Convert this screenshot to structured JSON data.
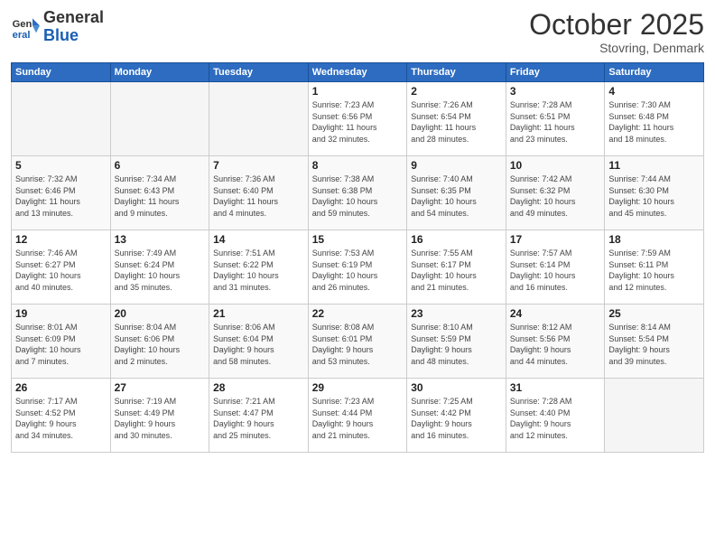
{
  "logo": {
    "line1": "General",
    "line2": "Blue"
  },
  "title": "October 2025",
  "location": "Stovring, Denmark",
  "days_of_week": [
    "Sunday",
    "Monday",
    "Tuesday",
    "Wednesday",
    "Thursday",
    "Friday",
    "Saturday"
  ],
  "weeks": [
    [
      {
        "num": "",
        "info": ""
      },
      {
        "num": "",
        "info": ""
      },
      {
        "num": "",
        "info": ""
      },
      {
        "num": "1",
        "info": "Sunrise: 7:23 AM\nSunset: 6:56 PM\nDaylight: 11 hours\nand 32 minutes."
      },
      {
        "num": "2",
        "info": "Sunrise: 7:26 AM\nSunset: 6:54 PM\nDaylight: 11 hours\nand 28 minutes."
      },
      {
        "num": "3",
        "info": "Sunrise: 7:28 AM\nSunset: 6:51 PM\nDaylight: 11 hours\nand 23 minutes."
      },
      {
        "num": "4",
        "info": "Sunrise: 7:30 AM\nSunset: 6:48 PM\nDaylight: 11 hours\nand 18 minutes."
      }
    ],
    [
      {
        "num": "5",
        "info": "Sunrise: 7:32 AM\nSunset: 6:46 PM\nDaylight: 11 hours\nand 13 minutes."
      },
      {
        "num": "6",
        "info": "Sunrise: 7:34 AM\nSunset: 6:43 PM\nDaylight: 11 hours\nand 9 minutes."
      },
      {
        "num": "7",
        "info": "Sunrise: 7:36 AM\nSunset: 6:40 PM\nDaylight: 11 hours\nand 4 minutes."
      },
      {
        "num": "8",
        "info": "Sunrise: 7:38 AM\nSunset: 6:38 PM\nDaylight: 10 hours\nand 59 minutes."
      },
      {
        "num": "9",
        "info": "Sunrise: 7:40 AM\nSunset: 6:35 PM\nDaylight: 10 hours\nand 54 minutes."
      },
      {
        "num": "10",
        "info": "Sunrise: 7:42 AM\nSunset: 6:32 PM\nDaylight: 10 hours\nand 49 minutes."
      },
      {
        "num": "11",
        "info": "Sunrise: 7:44 AM\nSunset: 6:30 PM\nDaylight: 10 hours\nand 45 minutes."
      }
    ],
    [
      {
        "num": "12",
        "info": "Sunrise: 7:46 AM\nSunset: 6:27 PM\nDaylight: 10 hours\nand 40 minutes."
      },
      {
        "num": "13",
        "info": "Sunrise: 7:49 AM\nSunset: 6:24 PM\nDaylight: 10 hours\nand 35 minutes."
      },
      {
        "num": "14",
        "info": "Sunrise: 7:51 AM\nSunset: 6:22 PM\nDaylight: 10 hours\nand 31 minutes."
      },
      {
        "num": "15",
        "info": "Sunrise: 7:53 AM\nSunset: 6:19 PM\nDaylight: 10 hours\nand 26 minutes."
      },
      {
        "num": "16",
        "info": "Sunrise: 7:55 AM\nSunset: 6:17 PM\nDaylight: 10 hours\nand 21 minutes."
      },
      {
        "num": "17",
        "info": "Sunrise: 7:57 AM\nSunset: 6:14 PM\nDaylight: 10 hours\nand 16 minutes."
      },
      {
        "num": "18",
        "info": "Sunrise: 7:59 AM\nSunset: 6:11 PM\nDaylight: 10 hours\nand 12 minutes."
      }
    ],
    [
      {
        "num": "19",
        "info": "Sunrise: 8:01 AM\nSunset: 6:09 PM\nDaylight: 10 hours\nand 7 minutes."
      },
      {
        "num": "20",
        "info": "Sunrise: 8:04 AM\nSunset: 6:06 PM\nDaylight: 10 hours\nand 2 minutes."
      },
      {
        "num": "21",
        "info": "Sunrise: 8:06 AM\nSunset: 6:04 PM\nDaylight: 9 hours\nand 58 minutes."
      },
      {
        "num": "22",
        "info": "Sunrise: 8:08 AM\nSunset: 6:01 PM\nDaylight: 9 hours\nand 53 minutes."
      },
      {
        "num": "23",
        "info": "Sunrise: 8:10 AM\nSunset: 5:59 PM\nDaylight: 9 hours\nand 48 minutes."
      },
      {
        "num": "24",
        "info": "Sunrise: 8:12 AM\nSunset: 5:56 PM\nDaylight: 9 hours\nand 44 minutes."
      },
      {
        "num": "25",
        "info": "Sunrise: 8:14 AM\nSunset: 5:54 PM\nDaylight: 9 hours\nand 39 minutes."
      }
    ],
    [
      {
        "num": "26",
        "info": "Sunrise: 7:17 AM\nSunset: 4:52 PM\nDaylight: 9 hours\nand 34 minutes."
      },
      {
        "num": "27",
        "info": "Sunrise: 7:19 AM\nSunset: 4:49 PM\nDaylight: 9 hours\nand 30 minutes."
      },
      {
        "num": "28",
        "info": "Sunrise: 7:21 AM\nSunset: 4:47 PM\nDaylight: 9 hours\nand 25 minutes."
      },
      {
        "num": "29",
        "info": "Sunrise: 7:23 AM\nSunset: 4:44 PM\nDaylight: 9 hours\nand 21 minutes."
      },
      {
        "num": "30",
        "info": "Sunrise: 7:25 AM\nSunset: 4:42 PM\nDaylight: 9 hours\nand 16 minutes."
      },
      {
        "num": "31",
        "info": "Sunrise: 7:28 AM\nSunset: 4:40 PM\nDaylight: 9 hours\nand 12 minutes."
      },
      {
        "num": "",
        "info": ""
      }
    ]
  ]
}
